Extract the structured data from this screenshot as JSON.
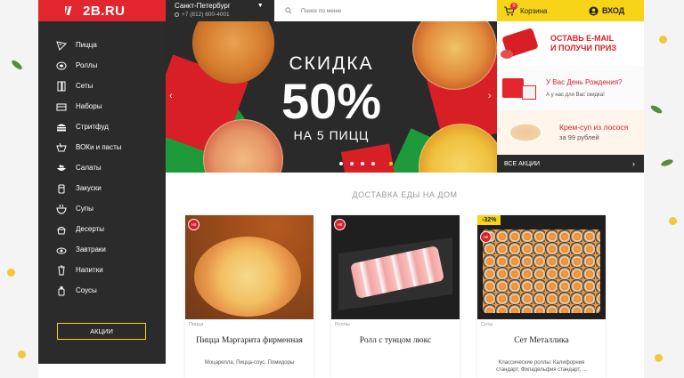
{
  "header": {
    "logo_text": "2B.RU",
    "city": "Санкт-Петербург",
    "phone": "+7 (812) 600-4001",
    "search_placeholder": "Поиск по меню",
    "cart_label": "Корзина",
    "cart_count": "0",
    "login_label": "ВХОД"
  },
  "sidebar": {
    "items": [
      {
        "label": "Пицца",
        "icon": "pizza-icon"
      },
      {
        "label": "Роллы",
        "icon": "roll-icon"
      },
      {
        "label": "Сеты",
        "icon": "set-icon"
      },
      {
        "label": "Наборы",
        "icon": "box-icon"
      },
      {
        "label": "Стритфуд",
        "icon": "burger-icon"
      },
      {
        "label": "ВОКи и пасты",
        "icon": "wok-icon"
      },
      {
        "label": "Салаты",
        "icon": "salad-icon"
      },
      {
        "label": "Закуски",
        "icon": "snack-icon"
      },
      {
        "label": "Супы",
        "icon": "soup-icon"
      },
      {
        "label": "Десерты",
        "icon": "dessert-icon"
      },
      {
        "label": "Завтраки",
        "icon": "breakfast-icon"
      },
      {
        "label": "Напитки",
        "icon": "drink-icon"
      },
      {
        "label": "Соусы",
        "icon": "sauce-icon"
      }
    ],
    "promo_button": "АКЦИИ"
  },
  "hero": {
    "title": "СКИДКА",
    "big": "50%",
    "subtitle": "НА 5 ПИЦЦ",
    "slide_count": 5,
    "active_slide": 4
  },
  "promos": {
    "p1_line1": "ОСТАВЬ E-MAIL",
    "p1_line2": "И ПОЛУЧИ ПРИЗ",
    "p2_title": "У Вас День Рождения?",
    "p2_text": "А у нас для Вас скидка!",
    "p3_title": "Крем-суп из лосося",
    "p3_text": "за 99 рублей",
    "all": "ВСЕ АКЦИИ"
  },
  "section": {
    "title": "ДОСТАВКА ЕДЫ НА ДОМ"
  },
  "products": [
    {
      "category": "Пицца",
      "name": "Пицца Маргарита фирменная",
      "desc": "Моцарелла, Пицца-соус, Помидоры",
      "badge": "Hit"
    },
    {
      "category": "Роллы",
      "name": "Ролл с тунцом люкс",
      "desc": "",
      "badge": "Hit"
    },
    {
      "category": "Сеты",
      "name": "Сет Металлика",
      "desc": "Классические роллы: Калифорния стандарт, Филадельфия стандарт, ...",
      "badge": "Hit",
      "discount": "-32%"
    }
  ],
  "colors": {
    "brand_red": "#e3262e",
    "accent_yellow": "#f7d417",
    "dark": "#2b2b2b"
  }
}
